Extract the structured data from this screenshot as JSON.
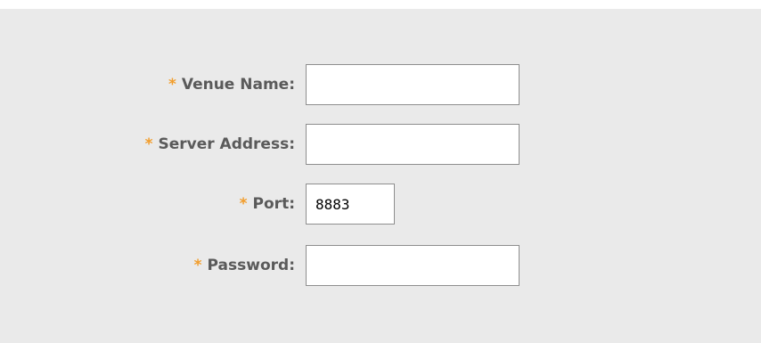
{
  "form": {
    "required_marker": "*",
    "fields": [
      {
        "label": "Venue Name:",
        "value": "",
        "placeholder": ""
      },
      {
        "label": "Server Address:",
        "value": "",
        "placeholder": ""
      },
      {
        "label": "Port:",
        "value": "8883",
        "placeholder": ""
      },
      {
        "label": "Password:",
        "value": "",
        "placeholder": ""
      }
    ]
  },
  "colors": {
    "panel_background": "#eaeaea",
    "required_marker": "#f29d2b",
    "label_text": "#5a5a5a",
    "input_border": "#8e8e8e"
  }
}
